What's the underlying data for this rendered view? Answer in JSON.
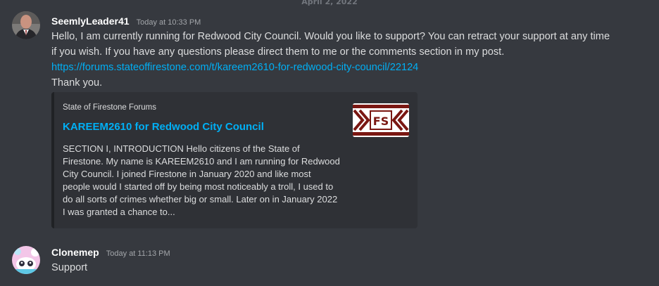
{
  "date_divider": "April 2, 2022",
  "messages": [
    {
      "username": "SeemlyLeader41",
      "timestamp": "Today at 10:33 PM",
      "lines": [
        "Hello, I am currently running for Redwood City Council. Would you like to support? You can retract your support at any time",
        "if you wish. If you have any questions please direct them to me or the comments section in my post.",
        "https://forums.stateoffirestone.com/t/kareem2610-for-redwood-city-council/22124",
        "Thank you."
      ],
      "embed": {
        "provider": "State of Firestone Forums",
        "title": "KAREEM2610 for Redwood City Council",
        "description_lines": [
          "SECTION I, INTRODUCTION Hello citizens of the State of",
          "Firestone. My name is KAREEM2610 and I am running for Redwood",
          "City Council. I joined Firestone in January 2020 and like most",
          "people would I started off by being most noticeably a troll, I used to",
          "do all sorts of crimes whether big or small. Later on in January 2022",
          "I was granted a chance to..."
        ],
        "thumbnail_text": "FS",
        "thumbnail_color": "#7a1712"
      }
    },
    {
      "username": "Clonemep",
      "timestamp": "Today at 11:13 PM",
      "lines": [
        "Support"
      ]
    }
  ],
  "colors": {
    "background": "#36393f",
    "embed_background": "#2f3136",
    "link": "#00aff4",
    "text": "#dcddde"
  }
}
